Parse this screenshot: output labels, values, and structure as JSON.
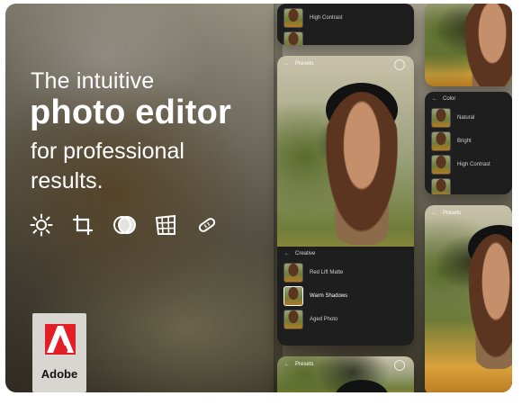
{
  "headline": {
    "line1": "The intuitive",
    "line2": "photo editor",
    "line3": "for professional",
    "line4": "results."
  },
  "tools": [
    {
      "icon": "light-icon"
    },
    {
      "icon": "crop-icon"
    },
    {
      "icon": "mask-icon"
    },
    {
      "icon": "geometry-icon"
    },
    {
      "icon": "heal-icon"
    }
  ],
  "brand": {
    "name": "Adobe"
  },
  "phones": {
    "top_strip": {
      "label": "High Contrast"
    },
    "main": {
      "top_label": "Presets",
      "panel_title": "Creative",
      "items": [
        "Red Lift Matte",
        "Warm Shadows",
        "Aged Photo"
      ],
      "selected_index": 1
    },
    "right_color_panel": {
      "panel_title": "Color",
      "items": [
        "Natural",
        "Bright",
        "High Contrast"
      ]
    },
    "bottom_left": {
      "top_label": "Presets"
    },
    "right_bottom": {
      "top_label": "Presets"
    }
  },
  "colors": {
    "panel_bg": "#1e1e1e",
    "adobe_red": "#e41e26",
    "badge_bg": "#d8d6d0"
  }
}
